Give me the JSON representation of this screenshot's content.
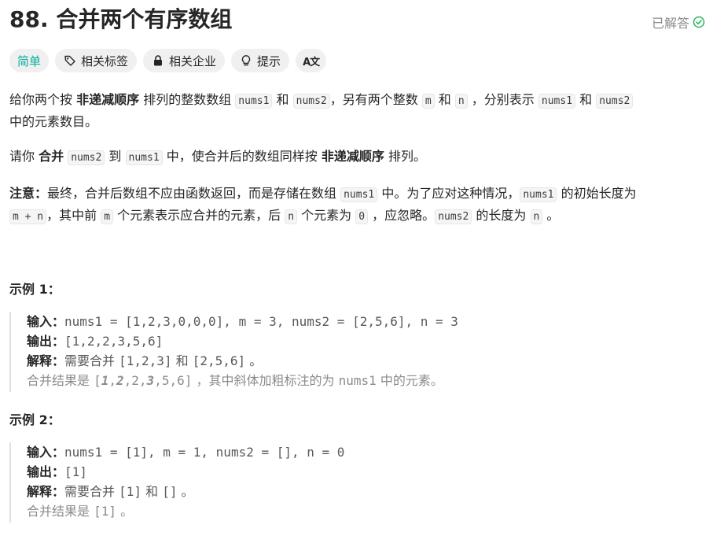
{
  "problem": {
    "title": "88. 合并两个有序数组",
    "status": "已解答"
  },
  "tags": {
    "difficulty": "简单",
    "related_tags": "相关标签",
    "related_companies": "相关企业",
    "hints": "提示",
    "translate": "A文"
  },
  "desc": {
    "p1": {
      "t1": "给你两个按 ",
      "b1": "非递减顺序",
      "t2": " 排列的整数数组 ",
      "c1": "nums1",
      "t3": " 和 ",
      "c2": "nums2",
      "t4": "，另有两个整数 ",
      "c3": "m",
      "t5": " 和 ",
      "c4": "n",
      "t6": " ，分别表示 ",
      "c5": "nums1",
      "t7": " 和 ",
      "c6": "nums2",
      "t8": "中的元素数目。"
    },
    "p2": {
      "t1": "请你 ",
      "b1": "合并",
      "t2": " ",
      "c1": "nums2",
      "t3": " 到 ",
      "c2": "nums1",
      "t4": " 中，使合并后的数组同样按 ",
      "b2": "非递减顺序",
      "t5": " 排列。"
    },
    "p3": {
      "b1": "注意：",
      "t1": "最终，合并后数组不应由函数返回，而是存储在数组 ",
      "c1": "nums1",
      "t2": " 中。为了应对这种情况，",
      "c2": "nums1",
      "t3": " 的初始长度为 ",
      "c3": "m + n",
      "t4": "，其中前 ",
      "c4": "m",
      "t5": " 个元素表示应合并的元素，后 ",
      "c5": "n",
      "t6": " 个元素为 ",
      "c6": "0",
      "t7": " ，应忽略。",
      "c7": "nums2",
      "t8": " 的长度为 ",
      "c8": "n",
      "t9": " 。"
    }
  },
  "examples": [
    {
      "heading": "示例 1：",
      "input_label": "输入：",
      "input": "nums1 = [1,2,3,0,0,0], m = 3, nums2 = [2,5,6], n = 3",
      "output_label": "输出：",
      "output": "[1,2,2,3,5,6]",
      "explain_label": "解释：",
      "explain_t1": "需要合并 ",
      "explain_c1": "[1,2,3]",
      "explain_t2": " 和 ",
      "explain_c2": "[2,5,6]",
      "explain_t3": " 。",
      "result_t1": "合并结果是 ",
      "result_open": "[",
      "result_b1": "1",
      "result_sep1": ",",
      "result_b2": "2",
      "result_mid": ",2,",
      "result_b3": "3",
      "result_rest": ",5,6]",
      "result_t2": " ，其中斜体加粗标注的为 ",
      "result_c1": "nums1",
      "result_t3": " 中的元素。"
    },
    {
      "heading": "示例 2：",
      "input_label": "输入：",
      "input": "nums1 = [1], m = 1, nums2 = [], n = 0",
      "output_label": "输出：",
      "output": "[1]",
      "explain_label": "解释：",
      "explain_t1": "需要合并 ",
      "explain_c1": "[1]",
      "explain_t2": " 和 ",
      "explain_c2": "[]",
      "explain_t3": " 。",
      "result_t1": "合并结果是 ",
      "result_c1": "[1]",
      "result_t2": " 。"
    }
  ],
  "colors": {
    "easy": "#00af9b",
    "solved_check": "#2db55d",
    "text": "#262626",
    "muted": "#8c8c8c"
  }
}
